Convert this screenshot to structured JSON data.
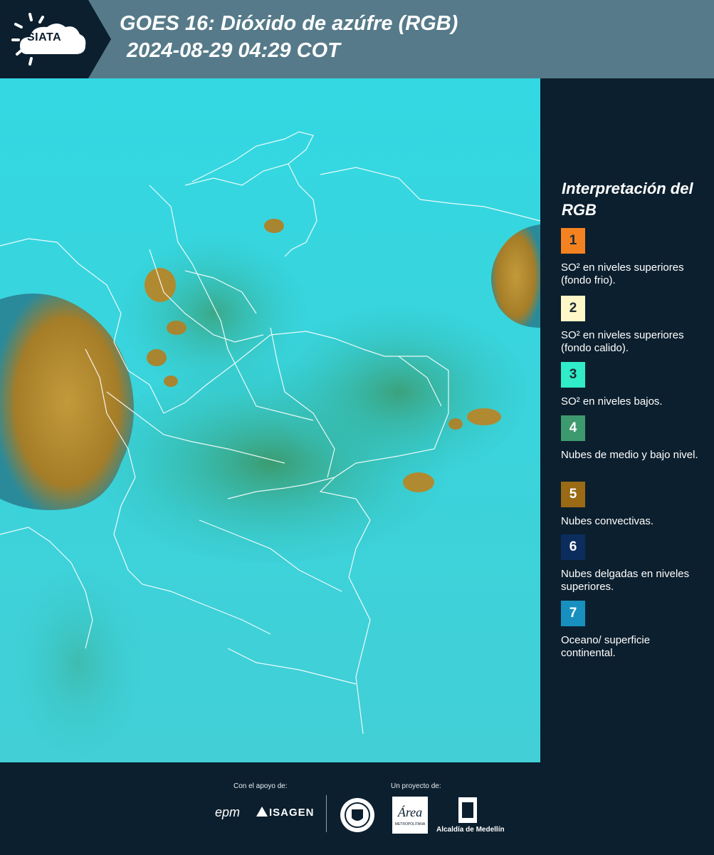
{
  "header": {
    "logo_text": "SIATA",
    "title_line1": "GOES 16: Dióxido de azúfre (RGB)",
    "title_line2": "2024-08-29 04:29 COT",
    "colors": {
      "dark": "#0c1f2e",
      "bar": "#567a89"
    }
  },
  "map": {
    "icon": "satellite-map-image",
    "colors": {
      "background": "#27d6de",
      "clouds": "#b88a2a",
      "low_clouds": "#3f9a70",
      "borders": "#ffffff"
    }
  },
  "legend": {
    "title": "Interpretación del RGB",
    "items": [
      {
        "number": "1",
        "color": "#f58220",
        "label": "SO² en niveles superiores (fondo frio)."
      },
      {
        "number": "2",
        "color": "#fff7c7",
        "label": "SO² en niveles superiores (fondo calido)."
      },
      {
        "number": "3",
        "color": "#30ecc8",
        "label": "SO² en niveles bajos."
      },
      {
        "number": "4",
        "color": "#3d9a6e",
        "label": "Nubes de medio y bajo nivel."
      },
      {
        "number": "5",
        "color": "#9a6a14",
        "label": "Nubes convectivas."
      },
      {
        "number": "6",
        "color": "#0b2d5e",
        "label": "Nubes delgadas en niveles superiores."
      },
      {
        "number": "7",
        "color": "#1790bf",
        "label": "Oceano/ superficie continental."
      }
    ]
  },
  "footer": {
    "support_label": "Con el apoyo de:",
    "project_label": "Un proyecto de:",
    "sponsors": [
      "epm",
      "ISAGEN"
    ],
    "partners": [
      "Área Metropolitana Valle de Aburrá",
      "Alcaldía de Medellín"
    ]
  }
}
